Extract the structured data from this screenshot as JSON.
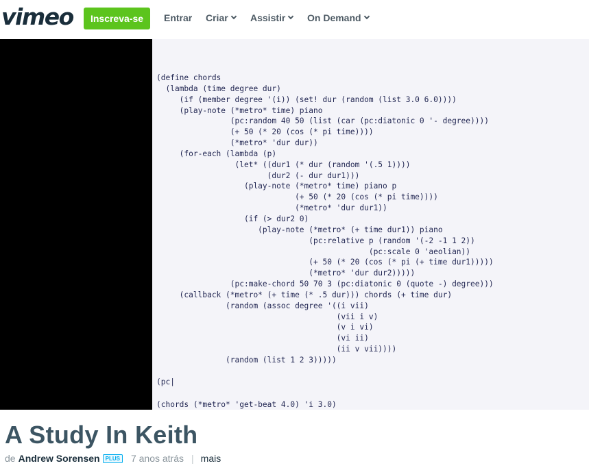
{
  "header": {
    "logo": "vimeo",
    "join_label": "Inscreva-se",
    "nav": [
      {
        "label": "Entrar",
        "dropdown": false
      },
      {
        "label": "Criar",
        "dropdown": true
      },
      {
        "label": "Assistir",
        "dropdown": true
      },
      {
        "label": "On Demand",
        "dropdown": true
      }
    ]
  },
  "video": {
    "code_lines": [
      "(define chords",
      "  (lambda (time degree dur)",
      "     (if (member degree '(i)) (set! dur (random (list 3.0 6.0))))",
      "     (play-note (*metro* time) piano",
      "                (pc:random 40 50 (list (car (pc:diatonic 0 '- degree))))",
      "                (+ 50 (* 20 (cos (* pi time))))",
      "                (*metro* 'dur dur))",
      "     (for-each (lambda (p)",
      "                 (let* ((dur1 (* dur (random '(.5 1))))",
      "                        (dur2 (- dur dur1)))",
      "                   (play-note (*metro* time) piano p",
      "                              (+ 50 (* 20 (cos (* pi time))))",
      "                              (*metro* 'dur dur1))",
      "                   (if (> dur2 0)",
      "                      (play-note (*metro* (+ time dur1)) piano",
      "                                 (pc:relative p (random '(-2 -1 1 2))",
      "                                              (pc:scale 0 'aeolian))",
      "                                 (+ 50 (* 20 (cos (* pi (+ time dur1)))))",
      "                                 (*metro* 'dur dur2)))))",
      "                (pc:make-chord 50 70 3 (pc:diatonic 0 (quote -) degree)))",
      "     (callback (*metro* (+ time (* .5 dur))) chords (+ time dur)",
      "               (random (assoc degree '((i vii)",
      "                                       (vii i v)",
      "                                       (v i vi)",
      "                                       (vi ii)",
      "                                       (ii v vii))))",
      "               (random (list 1 2 3)))))"
    ],
    "cursor_line": "(pc|",
    "last_line": "(chords (*metro* 'get-beat 4.0) 'i 3.0)"
  },
  "details": {
    "title": "A Study In Keith",
    "by_label": "de",
    "author": "Andrew Sorensen",
    "badge": "PLUS",
    "time_ago": "7 anos atrás",
    "separator": "|",
    "more_label": "mais"
  },
  "colors": {
    "join_button": "#5cc41d",
    "code_bg": "#f4f4f9",
    "title": "#3c5563",
    "badge": "#00adef"
  }
}
